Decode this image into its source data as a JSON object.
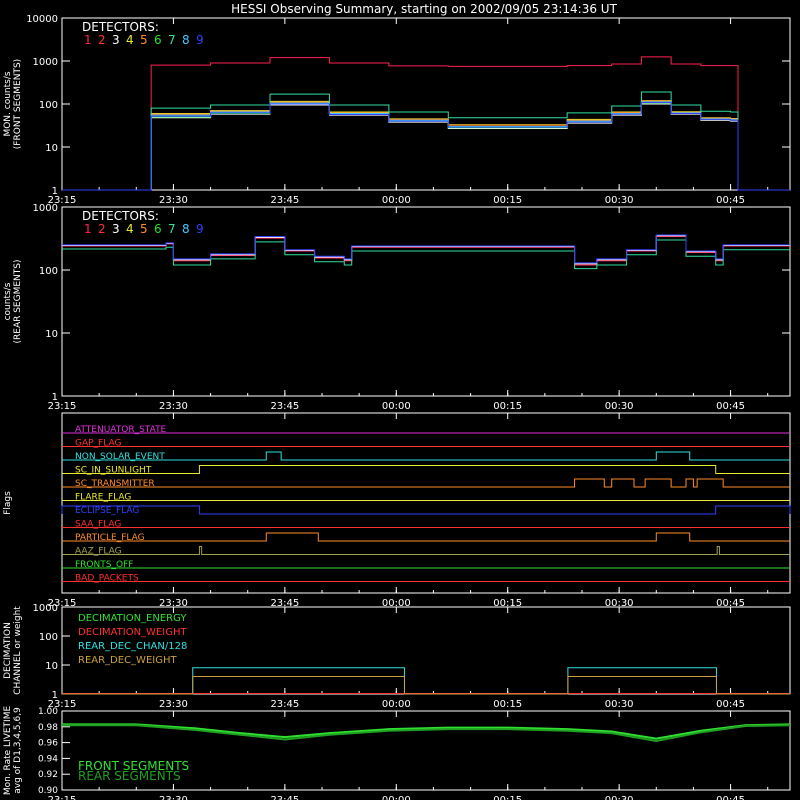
{
  "title": "HESSI Observing Summary, starting on 2002/09/05 23:14:36 UT",
  "time_axis": {
    "tick_labels": [
      "23:15",
      "23:30",
      "23:45",
      "00:00",
      "00:15",
      "00:30",
      "00:45"
    ],
    "range_minutes_since_2315": [
      0,
      98
    ]
  },
  "chart_data": [
    {
      "type": "line",
      "panel": "front",
      "ylabel": [
        "MON. counts/s",
        "(FRONT SEGMENTS)"
      ],
      "yscale": "log",
      "ylim": [
        1,
        10000
      ],
      "y_tick_labels": [
        "1",
        "10",
        "100",
        "1000",
        "10000"
      ],
      "legend_title": "DETECTORS:",
      "legend_labels": [
        "1",
        "2",
        "3",
        "4",
        "5",
        "6",
        "7",
        "8",
        "9"
      ],
      "colors": [
        "#ff2050",
        "#ff3030",
        "#ffffff",
        "#e8e830",
        "#ff8c28",
        "#28e028",
        "#30e0a0",
        "#40c8ff",
        "#3040ff"
      ],
      "x_minutes": [
        0,
        11.5,
        12,
        20,
        28,
        36,
        44,
        52,
        60,
        68,
        74,
        78,
        82,
        86,
        90,
        91,
        98
      ],
      "series": [
        {
          "name": "1",
          "values": [
            1,
            1,
            800,
            900,
            1200,
            900,
            770,
            750,
            750,
            780,
            850,
            1250,
            850,
            780,
            780,
            1,
            1
          ]
        },
        {
          "name": "2",
          "values": [
            1,
            1,
            55,
            65,
            100,
            60,
            42,
            30,
            30,
            40,
            60,
            110,
            62,
            45,
            42,
            1,
            1
          ]
        },
        {
          "name": "3",
          "values": [
            1,
            1,
            48,
            58,
            95,
            55,
            38,
            27,
            27,
            36,
            55,
            100,
            58,
            42,
            40,
            1,
            1
          ]
        },
        {
          "name": "4",
          "values": [
            1,
            1,
            60,
            70,
            115,
            65,
            45,
            33,
            33,
            44,
            65,
            120,
            66,
            48,
            46,
            1,
            1
          ]
        },
        {
          "name": "5",
          "values": [
            1,
            1,
            58,
            68,
            110,
            62,
            44,
            32,
            32,
            42,
            63,
            118,
            64,
            47,
            45,
            1,
            1
          ]
        },
        {
          "name": "6",
          "values": [
            1,
            1,
            50,
            60,
            100,
            58,
            40,
            28,
            28,
            38,
            58,
            105,
            60,
            44,
            42,
            1,
            1
          ]
        },
        {
          "name": "7",
          "values": [
            1,
            1,
            80,
            95,
            170,
            95,
            65,
            48,
            48,
            62,
            90,
            190,
            95,
            68,
            65,
            1,
            1
          ]
        },
        {
          "name": "8",
          "values": [
            1,
            1,
            55,
            65,
            105,
            60,
            42,
            30,
            30,
            40,
            60,
            112,
            62,
            45,
            43,
            1,
            1
          ]
        },
        {
          "name": "9",
          "values": [
            1,
            1,
            52,
            62,
            100,
            57,
            40,
            29,
            29,
            38,
            58,
            108,
            60,
            44,
            42,
            1,
            1
          ]
        }
      ]
    },
    {
      "type": "line",
      "panel": "rear",
      "ylabel": [
        "counts/s",
        "(REAR SEGMENTS)"
      ],
      "yscale": "log",
      "ylim": [
        1,
        1000
      ],
      "y_tick_labels": [
        "1",
        "10",
        "100",
        "1000"
      ],
      "legend_title": "DETECTORS:",
      "legend_labels": [
        "1",
        "2",
        "3",
        "4",
        "5",
        "6",
        "7",
        "8",
        "9"
      ],
      "colors": [
        "#ff2050",
        "#ff3030",
        "#ffffff",
        "#e8e830",
        "#ff8c28",
        "#28e028",
        "#30e0a0",
        "#40c8ff",
        "#3040ff"
      ],
      "x_minutes": [
        0,
        14,
        15,
        20,
        26,
        30,
        34,
        38,
        39,
        46,
        50,
        55,
        60,
        68,
        69,
        72,
        76,
        80,
        84,
        88,
        89,
        98
      ],
      "series": [
        {
          "name": "1",
          "values": [
            240,
            260,
            140,
            170,
            320,
            200,
            155,
            140,
            230,
            230,
            230,
            230,
            230,
            230,
            120,
            140,
            200,
            340,
            190,
            140,
            240,
            240
          ]
        },
        {
          "name": "3",
          "values": [
            245,
            265,
            145,
            175,
            330,
            205,
            160,
            145,
            235,
            235,
            235,
            235,
            235,
            235,
            125,
            145,
            205,
            350,
            195,
            145,
            245,
            245
          ]
        },
        {
          "name": "7",
          "values": [
            215,
            230,
            120,
            150,
            280,
            175,
            135,
            120,
            200,
            200,
            200,
            200,
            200,
            200,
            105,
            120,
            175,
            300,
            165,
            120,
            210,
            210
          ]
        },
        {
          "name": "9",
          "values": [
            250,
            270,
            150,
            180,
            340,
            210,
            165,
            150,
            240,
            240,
            240,
            240,
            240,
            240,
            130,
            150,
            210,
            360,
            200,
            150,
            250,
            250
          ]
        }
      ]
    },
    {
      "type": "table",
      "panel": "flags",
      "ylabel": [
        "Flags"
      ],
      "flags": [
        {
          "name": "ATTENUATOR_STATE",
          "color": "#e030e0",
          "on_intervals": []
        },
        {
          "name": "GAP_FLAG",
          "color": "#ff3030",
          "on_intervals": []
        },
        {
          "name": "NON_SOLAR_EVENT",
          "color": "#30e0e0",
          "on_intervals": [
            [
              27.5,
              29.5
            ],
            [
              80,
              84.5
            ]
          ]
        },
        {
          "name": "SC_IN_SUNLIGHT",
          "color": "#e8e830",
          "on_intervals": [
            [
              18.5,
              88
            ]
          ]
        },
        {
          "name": "SC_TRANSMITTER",
          "color": "#ff8c28",
          "on_intervals": [
            [
              69,
              73
            ],
            [
              74,
              77
            ],
            [
              78.5,
              82
            ],
            [
              84,
              85
            ],
            [
              85.5,
              89
            ]
          ]
        },
        {
          "name": "FLARE_FLAG",
          "color": "#e8e830",
          "on_intervals": []
        },
        {
          "name": "ECLIPSE_FLAG",
          "color": "#3040ff",
          "on_intervals": [
            [
              0,
              18.5
            ],
            [
              88,
              98
            ]
          ]
        },
        {
          "name": "SAA_FLAG",
          "color": "#ff3030",
          "on_intervals": []
        },
        {
          "name": "PARTICLE_FLAG",
          "color": "#ff8c28",
          "on_intervals": [
            [
              27.5,
              34.5
            ],
            [
              80,
              84.5
            ]
          ]
        },
        {
          "name": "AAZ_FLAG",
          "color": "#a0a050",
          "on_intervals": [
            [
              18.5,
              18.8
            ],
            [
              88.2,
              88.5
            ]
          ]
        },
        {
          "name": "FRONTS_OFF",
          "color": "#30e030",
          "on_intervals": []
        },
        {
          "name": "BAD_PACKETS",
          "color": "#ff3030",
          "on_intervals": []
        }
      ]
    },
    {
      "type": "line",
      "panel": "decimation",
      "ylabel": [
        "DECIMATION",
        "CHANNEL or weight"
      ],
      "yscale": "log",
      "ylim": [
        1,
        1000
      ],
      "y_tick_labels": [
        "1",
        "10",
        "100",
        "1000"
      ],
      "x_minutes": [
        0,
        17.5,
        17.6,
        46,
        46.1,
        68,
        68.1,
        99,
        99.1,
        98
      ],
      "series": [
        {
          "name": "DECIMATION_ENERGY",
          "color": "#30e030",
          "values": [
            1,
            1,
            1,
            1,
            1,
            1,
            1,
            1,
            1,
            1
          ]
        },
        {
          "name": "DECIMATION_WEIGHT",
          "color": "#ff3030",
          "values": [
            1,
            1,
            1,
            1,
            1,
            1,
            1,
            1,
            1,
            1
          ]
        },
        {
          "name": "REAR_DEC_CHAN/128",
          "color": "#30e0e0",
          "values": [
            1,
            1,
            8,
            8,
            1,
            1,
            8,
            8,
            1,
            1
          ]
        },
        {
          "name": "REAR_DEC_WEIGHT",
          "color": "#c8a040",
          "values": [
            1,
            1,
            4,
            4,
            1,
            1,
            4,
            4,
            1,
            1
          ]
        }
      ]
    },
    {
      "type": "line",
      "panel": "livetime",
      "ylabel": [
        "Mon. Rate LIVETIME",
        "avg of D1,3,4,5,6,9"
      ],
      "ylim": [
        0.9,
        1.0
      ],
      "y_tick_labels": [
        "0.90",
        "0.92",
        "0.94",
        "0.96",
        "0.98",
        "1.00"
      ],
      "x_minutes": [
        0,
        10,
        18,
        24,
        30,
        36,
        44,
        52,
        60,
        68,
        74,
        80,
        86,
        92,
        98
      ],
      "series": [
        {
          "name": "FRONT SEGMENTS",
          "color": "#30e030",
          "values": [
            0.983,
            0.983,
            0.978,
            0.972,
            0.967,
            0.972,
            0.977,
            0.979,
            0.979,
            0.977,
            0.974,
            0.965,
            0.975,
            0.982,
            0.983
          ]
        },
        {
          "name": "REAR SEGMENTS",
          "color": "#20a020",
          "values": [
            0.982,
            0.982,
            0.976,
            0.97,
            0.964,
            0.97,
            0.975,
            0.977,
            0.977,
            0.975,
            0.972,
            0.962,
            0.973,
            0.981,
            0.982
          ]
        }
      ]
    }
  ]
}
